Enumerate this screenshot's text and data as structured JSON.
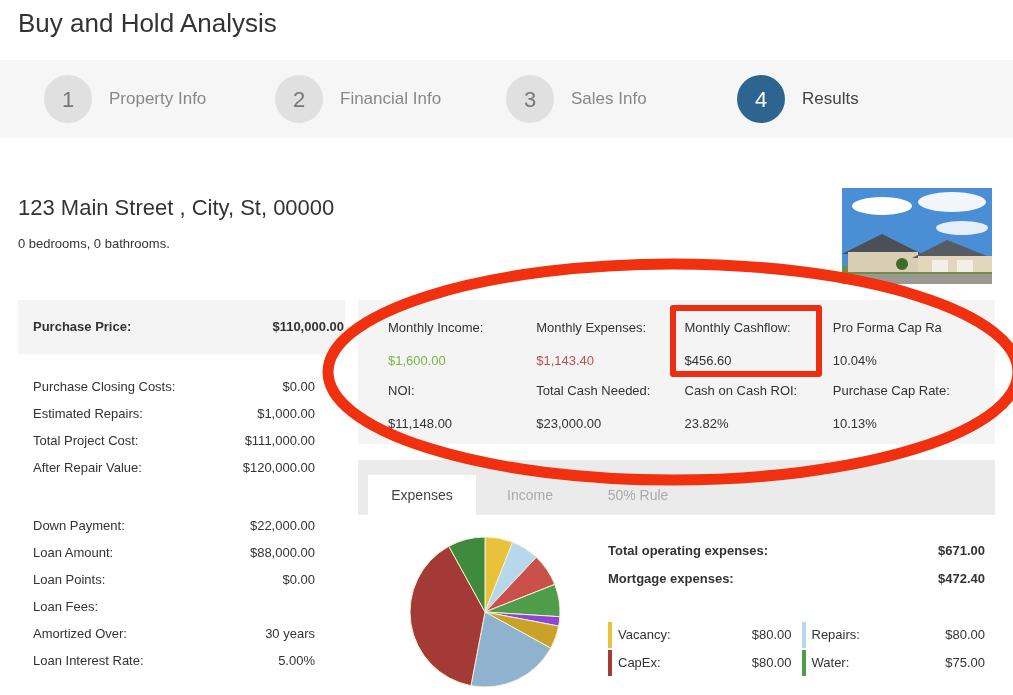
{
  "title": "Buy and Hold Analysis",
  "steps": [
    {
      "number": "1",
      "label": "Property Info",
      "selected": false
    },
    {
      "number": "2",
      "label": "Financial Info",
      "selected": false
    },
    {
      "number": "3",
      "label": "Sales Info",
      "selected": false
    },
    {
      "number": "4",
      "label": "Results",
      "selected": true
    }
  ],
  "property": {
    "address": "123 Main Street , City, St, 00000",
    "details": "0 bedrooms, 0 bathrooms."
  },
  "purchase_price": {
    "label": "Purchase Price:",
    "value": "$110,000.00"
  },
  "summary_groups": [
    [
      {
        "label": "Purchase Closing Costs:",
        "value": "$0.00"
      },
      {
        "label": "Estimated Repairs:",
        "value": "$1,000.00"
      },
      {
        "label": "Total Project Cost:",
        "value": "$111,000.00"
      },
      {
        "label": "After Repair Value:",
        "value": "$120,000.00"
      }
    ],
    [
      {
        "label": "Down Payment:",
        "value": "$22,000.00"
      },
      {
        "label": "Loan Amount:",
        "value": "$88,000.00"
      },
      {
        "label": "Loan Points:",
        "value": "$0.00"
      },
      {
        "label": "Loan Fees:"
      },
      {
        "label": "Amortized Over:",
        "value": "30 years"
      },
      {
        "label": "Loan Interest Rate:",
        "value": "5.00%"
      }
    ]
  ],
  "metrics": [
    {
      "label": "Monthly Income:",
      "value": "$1,600.00",
      "color": "#7cb342"
    },
    {
      "label": "Monthly Expenses:",
      "value": "$1,143.40",
      "color": "#c0504d"
    },
    {
      "label": "Monthly Cashflow:",
      "value": "$456.60",
      "color": "#333333"
    },
    {
      "label": "Pro Forma Cap Ra",
      "value": "10.04%",
      "color": "#333333"
    },
    {
      "label": "NOI:",
      "value": "$11,148.00",
      "color": "#333333"
    },
    {
      "label": "Total Cash Needed:",
      "value": "$23,000.00",
      "color": "#333333"
    },
    {
      "label": "Cash on Cash ROI:",
      "value": "23.82%",
      "color": "#333333"
    },
    {
      "label": "Purchase Cap Rate:",
      "value": "10.13%",
      "color": "#333333"
    }
  ],
  "tabs": [
    {
      "label": "Expenses",
      "selected": true
    },
    {
      "label": "Income",
      "selected": false
    },
    {
      "label": "50% Rule",
      "selected": false
    }
  ],
  "expense_totals": [
    {
      "label": "Total operating expenses:",
      "value": "$671.00"
    },
    {
      "label": "Mortgage expenses:",
      "value": "$472.40"
    }
  ],
  "legend": [
    {
      "label": "Vacancy:",
      "value": "$80.00",
      "color": "#e8c23a"
    },
    {
      "label": "Repairs:",
      "value": "$80.00",
      "color": "#b6d7ec"
    },
    {
      "label": "CapEx:",
      "value": "$80.00",
      "color": "#a33a36"
    },
    {
      "label": "Water:",
      "value": "$75.00",
      "color": "#4f9d4a"
    }
  ]
}
